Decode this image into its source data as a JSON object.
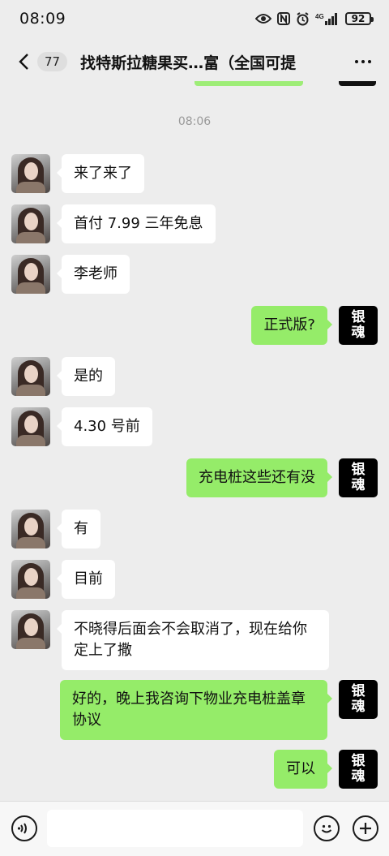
{
  "status_bar": {
    "time": "08:09",
    "network": "4G",
    "battery": "92"
  },
  "header": {
    "unread_count": "77",
    "title": "找特斯拉糖果买…富（全国可提"
  },
  "timestamp": "08:06",
  "messages": [
    {
      "side": "left",
      "text": "来了来了"
    },
    {
      "side": "left",
      "text": "首付 7.99 三年免息"
    },
    {
      "side": "left",
      "text": "李老师"
    },
    {
      "side": "right",
      "text": "正式版?"
    },
    {
      "side": "left",
      "text": "是的"
    },
    {
      "side": "left",
      "text": "4.30 号前"
    },
    {
      "side": "right",
      "text": "充电桩这些还有没"
    },
    {
      "side": "left",
      "text": "有"
    },
    {
      "side": "left",
      "text": "目前"
    },
    {
      "side": "left",
      "text": "不晓得后面会不会取消了，现在给你定上了撒"
    },
    {
      "side": "right",
      "text": "好的，晚上我咨询下物业充电桩盖章协议"
    },
    {
      "side": "right",
      "text": "可以"
    }
  ],
  "self_avatar_text": {
    "line1": "银",
    "line2": "魂"
  },
  "input": {
    "value": ""
  },
  "colors": {
    "background": "#ededed",
    "bubble_self": "#95ec69",
    "bubble_other": "#ffffff"
  },
  "icons": [
    "back-icon",
    "more-icon",
    "eye-icon",
    "nfc-icon",
    "alarm-icon",
    "signal-icon",
    "battery-icon",
    "voice-icon",
    "emoji-icon",
    "plus-icon"
  ]
}
